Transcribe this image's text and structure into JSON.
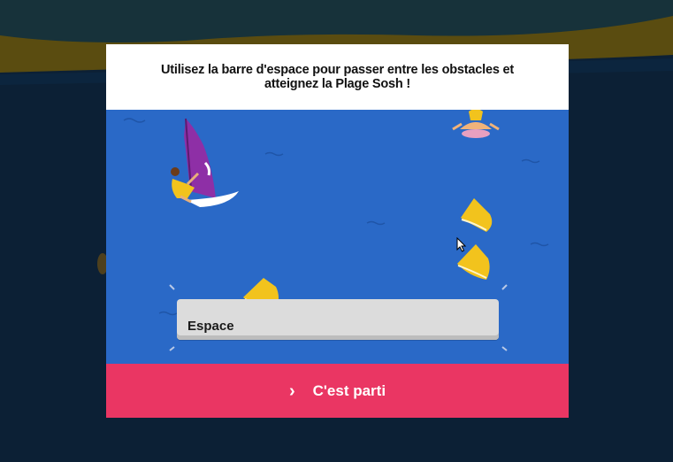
{
  "instructions": {
    "line1": "Utilisez la barre d'espace pour passer entre les obstacles et",
    "line2": "atteignez la Plage Sosh !"
  },
  "key_prompt": {
    "label": "Espace"
  },
  "start_button": {
    "label": "C'est parti",
    "icon": "chevron-right-icon"
  },
  "colors": {
    "sea": "#2a69c7",
    "button": "#ea3663",
    "buoy": "#f2c31d",
    "sail": "#8e2fa6",
    "night_water": "#0c2035",
    "sand": "#6e5a15"
  }
}
